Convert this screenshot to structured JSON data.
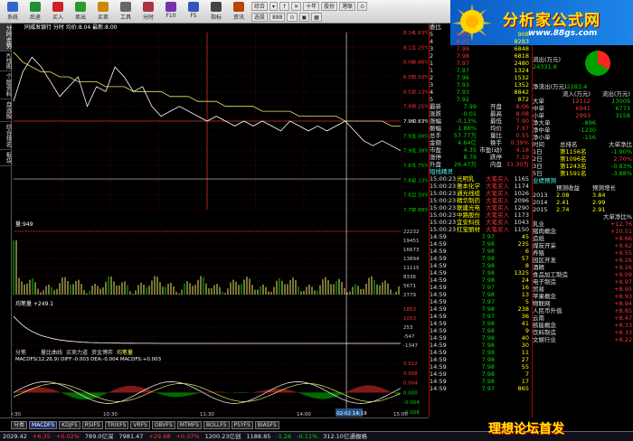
{
  "toolbar": {
    "buttons": [
      {
        "label": "系统",
        "icon": "home-icon",
        "color": "#3366cc"
      },
      {
        "label": "后退",
        "icon": "back-icon",
        "color": "#1f8f3a"
      },
      {
        "label": "买入",
        "icon": "buy-icon",
        "color": "#cc2222"
      },
      {
        "label": "卖出",
        "icon": "sell-icon",
        "color": "#2a9a2a"
      },
      {
        "label": "买卖",
        "icon": "trade-icon",
        "color": "#cc8800"
      },
      {
        "label": "工具",
        "icon": "tool-icon",
        "color": "#666666"
      },
      {
        "label": "分时",
        "icon": "timeshare-icon",
        "color": "#aa3344"
      },
      {
        "label": "F10",
        "icon": "f10-icon",
        "color": "#7733aa"
      },
      {
        "label": "F5",
        "icon": "f5-icon",
        "color": "#3355bb"
      },
      {
        "label": "指标",
        "icon": "indicator-icon",
        "color": "#444444"
      },
      {
        "label": "资讯",
        "icon": "news-icon",
        "color": "#bb4400"
      }
    ],
    "row1": [
      "综合",
      "▾",
      "↑",
      "✕",
      "十年",
      "股份",
      "港联",
      "⊙"
    ],
    "row2": [
      "选股",
      "888",
      "⊙",
      "▣",
      "▦"
    ]
  },
  "brand": {
    "title": "分析家公式网",
    "url": "www.88gs.com"
  },
  "left_tabs": [
    {
      "label": "分时走势",
      "active": true
    },
    {
      "label": "K线图"
    },
    {
      "label": "个股资料"
    },
    {
      "label": "自选股"
    },
    {
      "label": "综合排名"
    },
    {
      "label": "板块"
    }
  ],
  "chart": {
    "header": "同威发银行 分时 均价:8.04 最新:8.00",
    "vol_label": "量:949",
    "ddx_label": "均笔量 +249.1",
    "macd_label": "MACDFS(12,26,9) DIFF:-0.003 DEA:-0.004 MACDFS:+0.003",
    "price_ticks": [
      "8.14",
      "8.11",
      "8.08",
      "8.05",
      "8.02",
      "7.99",
      "7.96",
      "7.93",
      "7.90",
      "7.87",
      "7.84",
      "7.81",
      "7.78"
    ],
    "pct_ticks": [
      "1.63%",
      "1.25%",
      "0.88%",
      "0.50%",
      "0.13%",
      "0.25%",
      "0.63%",
      "1.00%",
      "1.38%",
      "1.75%",
      "2.13%",
      "2.50%",
      "2.88%"
    ],
    "vol_ticks": [
      "22232",
      "19451",
      "16673",
      "13894",
      "11115",
      "8336",
      "5671",
      "2779"
    ],
    "ddx_ticks": [
      "1853",
      "1053",
      "253",
      "-547",
      "-1347"
    ],
    "macd_ticks": [
      "0.012",
      "0.008",
      "0.004",
      "0.000",
      "-0.004",
      "-0.008"
    ],
    "time_labels": [
      "09:30",
      "10:30",
      "11:30",
      "14:00",
      "15:00"
    ],
    "sub_tabs": [
      "分笔",
      "量比曲线",
      "买卖力道",
      "资金博弈",
      "均笔量"
    ],
    "cursor_time": "02-02 14:19",
    "price_line": [
      8.0,
      8.06,
      8.09,
      8.07,
      8.04,
      8.01,
      8.03,
      8.05,
      7.99,
      8.03,
      8.02,
      8.07,
      8.05,
      8.02,
      8.03,
      7.99,
      7.97,
      7.98,
      7.99,
      7.98,
      7.97,
      7.96,
      7.97,
      7.96,
      7.95,
      7.96,
      7.95,
      7.96,
      7.95,
      7.94,
      7.96,
      7.95,
      7.94,
      7.95,
      7.94,
      7.95,
      7.96,
      7.94,
      7.92,
      7.91,
      7.92,
      7.91,
      7.9
    ],
    "avg_line": [
      8.1,
      8.08,
      8.07,
      8.06,
      8.06,
      8.05,
      8.05,
      8.04,
      8.04,
      8.04,
      8.03,
      8.03,
      8.03,
      8.02,
      8.02,
      8.02,
      8.02,
      8.01,
      8.01,
      8.01,
      8.0,
      8.0,
      8.0,
      7.99,
      7.99,
      7.99,
      7.99,
      7.98,
      7.98,
      7.98,
      7.98,
      7.97,
      7.97,
      7.97,
      7.97,
      7.97,
      7.96,
      7.96,
      7.96,
      7.96,
      7.96,
      7.95,
      7.95
    ]
  },
  "bottom_tabs": [
    "分类",
    "MACDFS",
    "KDJFS",
    "RSIFS",
    "TRIXFS",
    "VRFS",
    "OBVFS",
    "MTMFS",
    "BOLLFS",
    "PSYFS",
    "BIASFS"
  ],
  "quote": {
    "title": "委比",
    "code": "88",
    "sells": [
      {
        "label": "5",
        "price": "8.05",
        "vol": "908"
      },
      {
        "label": "4",
        "price": "8.01",
        "vol": "8283"
      },
      {
        "label": "3",
        "price": "7.99",
        "vol": "6848"
      },
      {
        "label": "2",
        "price": "7.98",
        "vol": "6818"
      },
      {
        "label": "1",
        "price": "7.97",
        "vol": "2480"
      }
    ],
    "buys": [
      {
        "label": "1",
        "price": "7.97",
        "vol": "1324"
      },
      {
        "label": "2",
        "price": "7.96",
        "vol": "1532"
      },
      {
        "label": "3",
        "price": "7.93",
        "vol": "1352"
      },
      {
        "label": "4",
        "price": "7.93",
        "vol": "8842"
      },
      {
        "label": "5",
        "price": "7.92",
        "vol": "872"
      }
    ],
    "stats": [
      [
        "最新",
        "7.99",
        "开盘",
        "8.06"
      ],
      [
        "涨跌",
        "-0.01",
        "最高",
        "8.08"
      ],
      [
        "涨幅",
        "-0.13%",
        "最低",
        "7.90"
      ],
      [
        "振幅",
        "1.88%",
        "均价",
        "7.97"
      ],
      [
        "总手",
        "57.77万",
        "量比",
        "0.55"
      ],
      [
        "金额",
        "4.64亿",
        "换手",
        "0.39%"
      ],
      [
        "市盈",
        "4.35",
        "市盈(动)",
        "4.18"
      ],
      [
        "涨停",
        "8.79",
        "跌停",
        "7.19"
      ],
      [
        "外盘",
        "26.47万",
        "内盘",
        "31.30万"
      ]
    ]
  },
  "funds": {
    "out_label": "流出(万元)",
    "out_val": "24331.8",
    "net_label": "净流出(万元)",
    "net_val": "2283.4",
    "head": [
      "流入(万元)",
      "流出(万元)"
    ],
    "rows": [
      [
        "大单",
        "12112",
        "13009"
      ],
      [
        "中单",
        "6941",
        "6773"
      ],
      [
        "小单",
        "2993",
        "3158"
      ]
    ],
    "net": [
      [
        "净大单",
        "-896"
      ],
      [
        "净中单",
        "-1230"
      ],
      [
        "净小单",
        "-156"
      ]
    ]
  },
  "ranks": {
    "head": [
      "时间",
      "总排名",
      "大单净比"
    ],
    "rows": [
      [
        "1日",
        "第1156名",
        "-1.90%"
      ],
      [
        "2日",
        "第1096名",
        "2.70%"
      ],
      [
        "3日",
        "第1243名",
        "-0.83%"
      ],
      [
        "5日",
        "第1591名",
        "-3.88%"
      ]
    ]
  },
  "forecast": {
    "title": "业绩预测",
    "head": [
      "",
      "预测收益",
      "预测增长"
    ],
    "rows": [
      [
        "2013",
        "2.08",
        "3.84"
      ],
      [
        "2014",
        "2.41",
        "2.99"
      ],
      [
        "2015",
        "2.74",
        "2.91"
      ]
    ]
  },
  "ticks": {
    "rows": [
      [
        "15:00:23",
        "光明乳",
        "大笔买入",
        "1165"
      ],
      [
        "15:00:23",
        "雅本化学",
        "大笔买入",
        "1174"
      ],
      [
        "15:00:23",
        "通光线缆",
        "大笔买入",
        "1026"
      ],
      [
        "15:00:23",
        "精华制药",
        "大笔买入",
        "2096"
      ],
      [
        "15:00:23",
        "联建光电",
        "大笔买入",
        "1290"
      ],
      [
        "15:00:23",
        "中路股份",
        "大笔买入",
        "1173"
      ],
      [
        "15:00:23",
        "宜安科技",
        "大笔买入",
        "1043"
      ],
      [
        "15:00:23",
        "红宝丽材",
        "大笔买入",
        "1150"
      ]
    ],
    "tab": "短线精灵"
  },
  "trades": [
    [
      "14:59",
      "7.97",
      "45"
    ],
    [
      "14:59",
      "7.98",
      "235"
    ],
    [
      "14:59",
      "7.98",
      "6"
    ],
    [
      "14:59",
      "7.98",
      "57"
    ],
    [
      "14:59",
      "7.98",
      "8"
    ],
    [
      "14:59",
      "7.98",
      "1325"
    ],
    [
      "14:59",
      "7.98",
      "24"
    ],
    [
      "14:59",
      "7.97",
      "16"
    ],
    [
      "14:59",
      "7.98",
      "13"
    ],
    [
      "14:59",
      "7.97",
      "5"
    ],
    [
      "14:59",
      "7.98",
      "238"
    ],
    [
      "14:59",
      "7.97",
      "36"
    ],
    [
      "14:59",
      "7.98",
      "41"
    ],
    [
      "14:59",
      "7.98",
      "9"
    ],
    [
      "14:59",
      "7.98",
      "40"
    ],
    [
      "14:59",
      "7.98",
      "30"
    ],
    [
      "14:59",
      "7.98",
      "11"
    ],
    [
      "14:59",
      "7.98",
      "27"
    ],
    [
      "14:59",
      "7.98",
      "55"
    ],
    [
      "14:59",
      "7.98",
      "7"
    ],
    [
      "14:59",
      "7.98",
      "17"
    ],
    [
      "14:59",
      "7.97",
      "865"
    ]
  ],
  "sectors": {
    "head": "大单净比%",
    "rows": [
      [
        "乳业",
        "+12.76"
      ],
      [
        "猪肉概念",
        "+10.51"
      ],
      [
        "造纸",
        "+9.66"
      ],
      [
        "煤炭开采",
        "+9.62"
      ],
      [
        "养殖",
        "+9.55"
      ],
      [
        "园区开发",
        "+9.26"
      ],
      [
        "酒精",
        "+9.26"
      ],
      [
        "食品加工制造",
        "+9.09"
      ],
      [
        "电子制造",
        "+8.97"
      ],
      [
        "贸易",
        "+8.95"
      ],
      [
        "苹果概念",
        "+8.93"
      ],
      [
        "物联网",
        "+8.94"
      ],
      [
        "人民币升值",
        "+8.85"
      ],
      [
        "云南",
        "+8.47"
      ],
      [
        "核能概念",
        "+8.33"
      ],
      [
        "饮料制造",
        "+8.33"
      ],
      [
        "文娱行业",
        "+8.22"
      ]
    ]
  },
  "status": [
    "2029.42",
    "+6.35",
    "+0.02%",
    "789.0亿深",
    "7981.47",
    "+29.68",
    "+0.37%",
    "1200.23亿创",
    "1188.85",
    "-1.26",
    "-0.11%",
    "312.10亿通报格"
  ],
  "watermark": "理想论坛首发"
}
